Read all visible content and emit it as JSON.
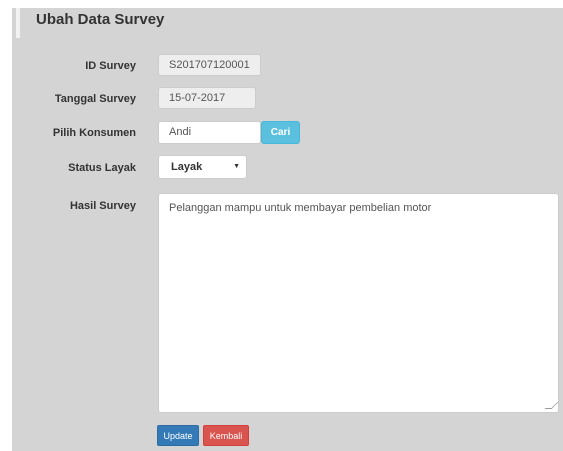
{
  "panel": {
    "title": "Ubah Data Survey"
  },
  "form": {
    "id_survey": {
      "label": "ID Survey",
      "value": "S201707120001"
    },
    "tanggal_survey": {
      "label": "Tanggal Survey",
      "value": "15-07-2017"
    },
    "pilih_konsumen": {
      "label": "Pilih Konsumen",
      "value": "Andi",
      "button_label": "Cari"
    },
    "status_layak": {
      "label": "Status Layak",
      "value": "Layak"
    },
    "hasil_survey": {
      "label": "Hasil Survey",
      "value": "Pelanggan mampu untuk membayar pembelian motor"
    }
  },
  "actions": {
    "update_label": "Update",
    "kembali_label": "Kembali"
  },
  "colors": {
    "primary": "#337ab7",
    "danger": "#d9534f",
    "info": "#5bc0de",
    "panel_bg": "#d4d4d4"
  },
  "icons": {
    "select_caret": "caret-down-icon"
  }
}
